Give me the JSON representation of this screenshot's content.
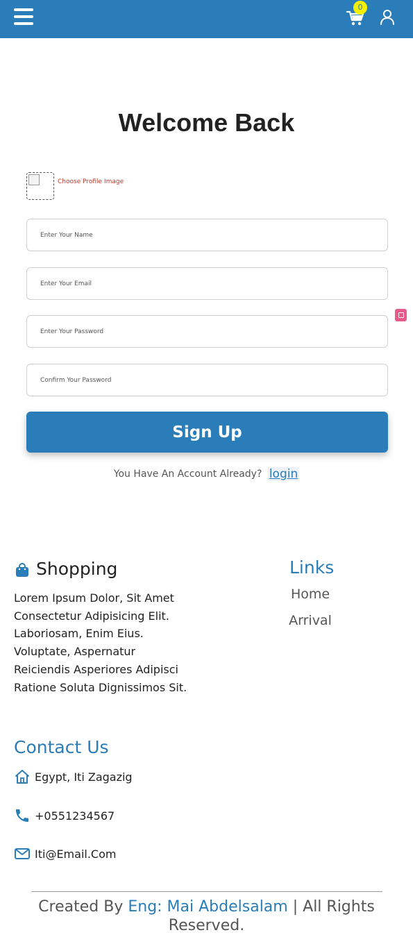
{
  "navbar": {
    "menu_icon": "hamburger-menu-icon",
    "cart_icon": "shopping-cart-icon",
    "cart_count": "0",
    "user_icon": "user-profile-icon",
    "background_color": "#2a7db8",
    "badge_color": "#f4f000"
  },
  "form": {
    "title": "Welcome Back",
    "profile_image_label": "Choose Profile Image",
    "fields": {
      "name_placeholder": "Enter Your Name",
      "email_placeholder": "Enter Your Email",
      "password_placeholder": "Enter Your Password",
      "confirm_placeholder": "Confirm Your Password"
    },
    "submit_label": "Sign Up",
    "have_account_text": "You Have An Account Already?",
    "login_link": "login"
  },
  "footer": {
    "shopping": {
      "icon": "shopping-bag-icon",
      "title": "Shopping",
      "description": "Lorem Ipsum Dolor, Sit Amet Consectetur Adipisicing Elit. Laboriosam, Enim Eius. Voluptate, Aspernatur Reiciendis Asperiores Adipisci Ratione Soluta Dignissimos Sit."
    },
    "links": {
      "title": "Links",
      "items": [
        "Home",
        "Arrival"
      ]
    },
    "contact": {
      "title": "Contact Us",
      "address": "Egypt, Iti Zagazig",
      "phone": "+0551234567",
      "email": "Iti@Email.Com",
      "address_icon": "home-icon",
      "phone_icon": "phone-icon",
      "email_icon": "envelope-icon"
    },
    "credits": {
      "prefix": "Created By",
      "author": "Eng: Mai Abdelsalam",
      "suffix": "| All Rights Reserved."
    },
    "accent_color": "#2a7db8"
  }
}
